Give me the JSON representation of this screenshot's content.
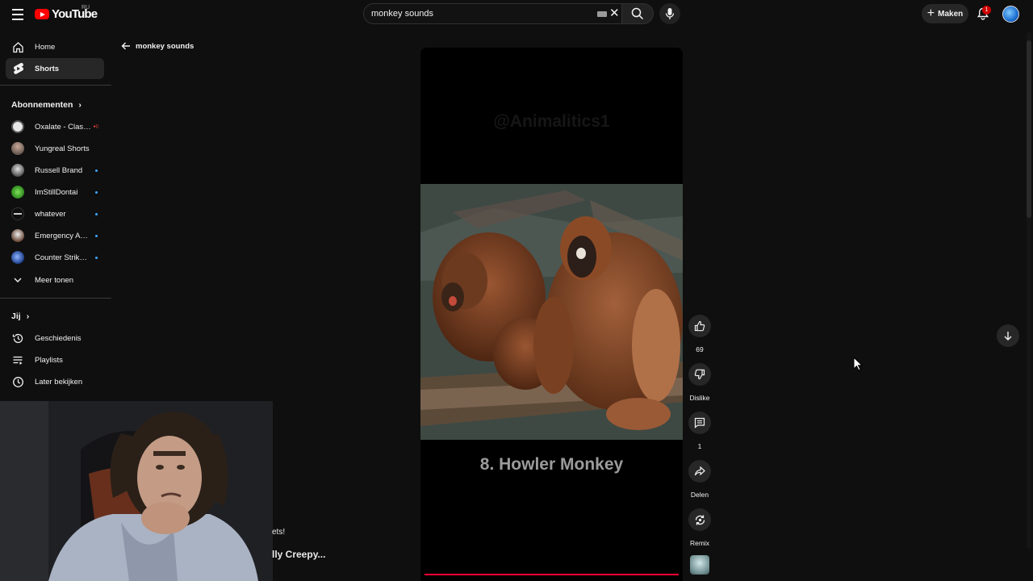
{
  "header": {
    "logo_text": "YouTube",
    "region": "RU",
    "search_value": "monkey sounds",
    "create_label": "Maken",
    "notification_count": "1"
  },
  "sidebar": {
    "home": "Home",
    "shorts": "Shorts",
    "subscriptions_title": "Abonnementen",
    "channels": [
      {
        "name": "Oxalate - Clash R...",
        "color": "#e8e8e8",
        "status": "live"
      },
      {
        "name": "Yungreal Shorts",
        "color": "#8a7a72",
        "status": "none"
      },
      {
        "name": "Russell Brand",
        "color": "#cfcfcf",
        "status": "new"
      },
      {
        "name": "ImStillDontai",
        "color": "#55c23a",
        "status": "new"
      },
      {
        "name": "whatever",
        "color": "#ffffff",
        "status": "new"
      },
      {
        "name": "Emergency Awe...",
        "color": "#c9c0b8",
        "status": "new"
      },
      {
        "name": "Counter Strike Pr...",
        "color": "#3a6ab8",
        "status": "new"
      }
    ],
    "show_more": "Meer tonen",
    "you_title": "Jij",
    "history": "Geschiedenis",
    "playlists": "Playlists",
    "watch_later": "Later bekijken"
  },
  "page": {
    "back_label": "monkey sounds"
  },
  "short": {
    "watermark": "@Animalitics1",
    "title": "8. Howler Monkey"
  },
  "actions": {
    "like_count": "69",
    "dislike_label": "Dislike",
    "comment_count": "1",
    "share_label": "Delen",
    "remix_label": "Remix"
  },
  "overlay": {
    "line1": "ets!",
    "line2": "lly Creepy..."
  },
  "colors": {
    "background": "#0f0f0f",
    "accent": "#ff0033",
    "panel": "#272727"
  }
}
